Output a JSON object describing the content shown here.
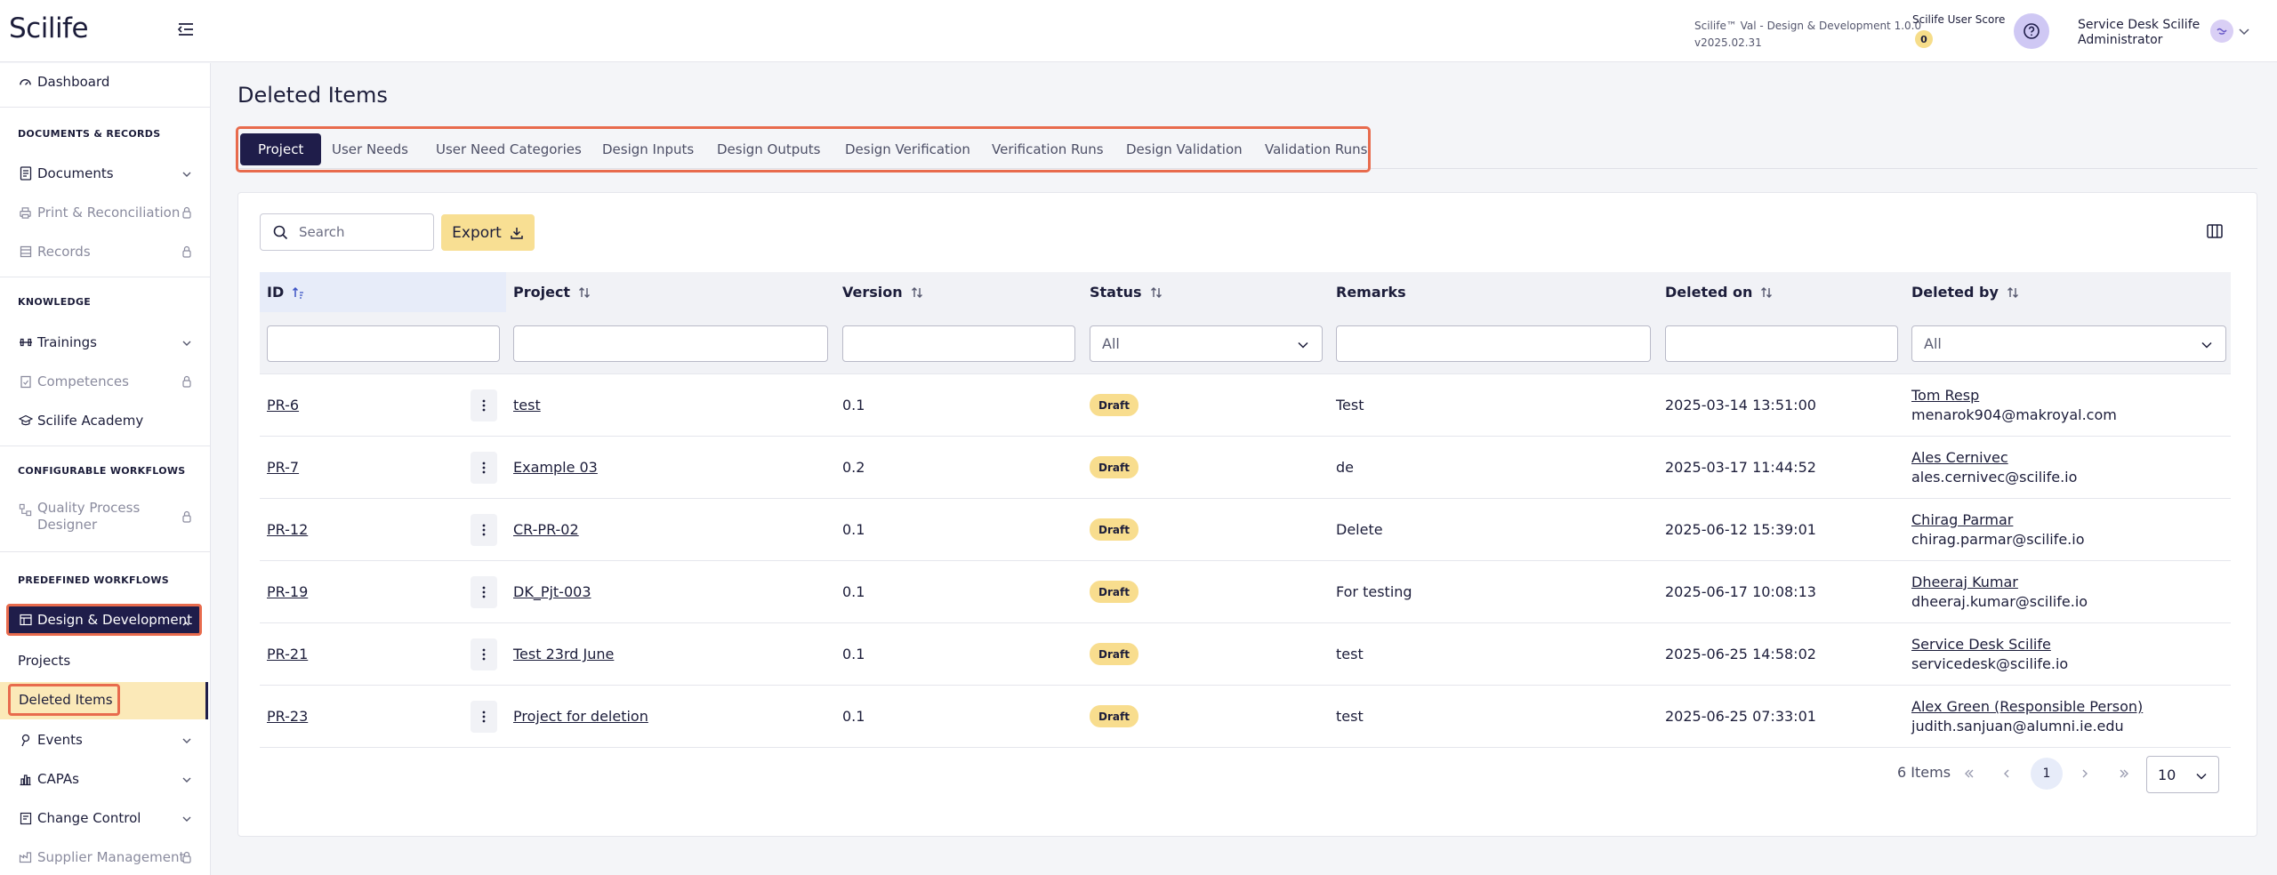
{
  "header": {
    "logo": "Scilife",
    "env_line1": "Scilife™ Val - Design & Development 1.0.0",
    "env_line2": "v2025.02.31",
    "score_label": "Scilife User Score",
    "score_value": "0",
    "user_name": "Service Desk Scilife Administrator"
  },
  "sidebar": {
    "dashboard": "Dashboard",
    "sec_docs": "DOCUMENTS & RECORDS",
    "documents": "Documents",
    "print": "Print & Reconciliation",
    "records": "Records",
    "sec_knowledge": "KNOWLEDGE",
    "trainings": "Trainings",
    "competences": "Competences",
    "academy": "Scilife Academy",
    "sec_config": "CONFIGURABLE WORKFLOWS",
    "qpd_line1": "Quality Process",
    "qpd_line2": "Designer",
    "sec_predefined": "PREDEFINED WORKFLOWS",
    "dd": "Design & Development",
    "projects": "Projects",
    "deleted": "Deleted Items",
    "events": "Events",
    "capas": "CAPAs",
    "change": "Change Control",
    "supplier": "Supplier Management"
  },
  "main": {
    "title": "Deleted Items",
    "tabs": [
      "Project",
      "User Needs",
      "User Need Categories",
      "Design Inputs",
      "Design Outputs",
      "Design Verification",
      "Verification Runs",
      "Design Validation",
      "Validation Runs"
    ],
    "search_placeholder": "Search",
    "export_label": "Export"
  },
  "table": {
    "columns": [
      "ID",
      "Project",
      "Version",
      "Status",
      "Remarks",
      "Deleted on",
      "Deleted by"
    ],
    "status_filter": "All",
    "deletedby_filter": "All",
    "rows": [
      {
        "id": "PR-6",
        "project": "test",
        "version": "0.1",
        "status": "Draft",
        "remarks": "Test",
        "deleted_on": "2025-03-14 13:51:00",
        "by_name": "Tom Resp",
        "by_email": "menarok904@makroyal.com"
      },
      {
        "id": "PR-7",
        "project": "Example 03",
        "version": "0.2",
        "status": "Draft",
        "remarks": "de",
        "deleted_on": "2025-03-17 11:44:52",
        "by_name": "Ales Cernivec",
        "by_email": "ales.cernivec@scilife.io"
      },
      {
        "id": "PR-12",
        "project": "CR-PR-02",
        "version": "0.1",
        "status": "Draft",
        "remarks": "Delete",
        "deleted_on": "2025-06-12 15:39:01",
        "by_name": "Chirag Parmar",
        "by_email": "chirag.parmar@scilife.io"
      },
      {
        "id": "PR-19",
        "project": "DK_Pjt-003",
        "version": "0.1",
        "status": "Draft",
        "remarks": "For testing",
        "deleted_on": "2025-06-17 10:08:13",
        "by_name": "Dheeraj Kumar",
        "by_email": "dheeraj.kumar@scilife.io"
      },
      {
        "id": "PR-21",
        "project": "Test 23rd June",
        "version": "0.1",
        "status": "Draft",
        "remarks": "test",
        "deleted_on": "2025-06-25 14:58:02",
        "by_name": "Service Desk Scilife",
        "by_email": "servicedesk@scilife.io"
      },
      {
        "id": "PR-23",
        "project": "Project for deletion",
        "version": "0.1",
        "status": "Draft",
        "remarks": "test",
        "deleted_on": "2025-06-25 07:33:01",
        "by_name": "Alex Green (Responsible Person)",
        "by_email": "judith.sanjuan@alumni.ie.edu"
      }
    ]
  },
  "pagination": {
    "count": "6 Items",
    "page": "1",
    "page_size": "10"
  },
  "colors": {
    "primary": "#1f1d4a",
    "accent_highlight": "#e86b4d",
    "badge": "#f8dd8e"
  }
}
